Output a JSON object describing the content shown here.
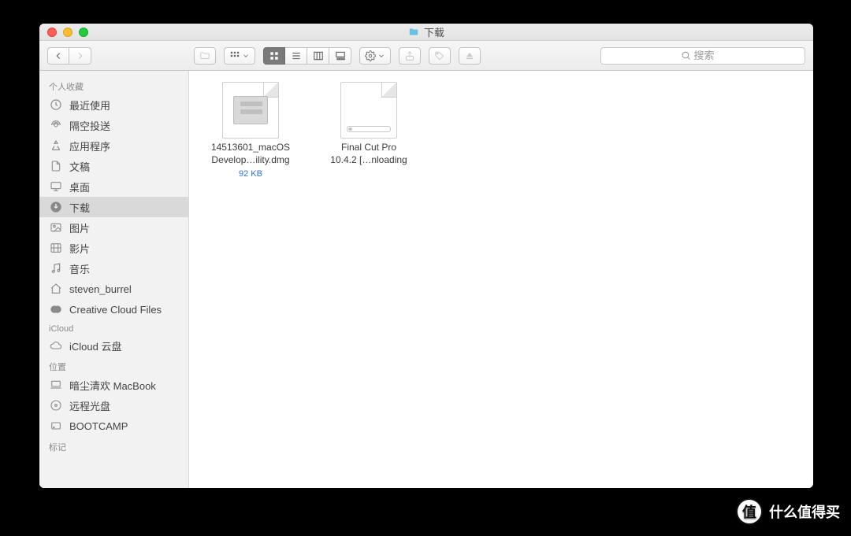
{
  "window": {
    "title": "下载"
  },
  "search": {
    "placeholder": "搜索"
  },
  "sidebar": {
    "sections": [
      {
        "header": "个人收藏",
        "items": [
          {
            "icon": "clock-icon",
            "label": "最近使用"
          },
          {
            "icon": "airdrop-icon",
            "label": "隔空投送"
          },
          {
            "icon": "apps-icon",
            "label": "应用程序"
          },
          {
            "icon": "doc-icon",
            "label": "文稿"
          },
          {
            "icon": "desktop-icon",
            "label": "桌面"
          },
          {
            "icon": "download-icon",
            "label": "下载",
            "selected": true
          },
          {
            "icon": "photo-icon",
            "label": "图片"
          },
          {
            "icon": "movie-icon",
            "label": "影片"
          },
          {
            "icon": "music-icon",
            "label": "音乐"
          },
          {
            "icon": "home-icon",
            "label": "steven_burrel"
          },
          {
            "icon": "cc-icon",
            "label": "Creative Cloud Files"
          }
        ]
      },
      {
        "header": "iCloud",
        "items": [
          {
            "icon": "cloud-icon",
            "label": "iCloud 云盘"
          }
        ]
      },
      {
        "header": "位置",
        "items": [
          {
            "icon": "laptop-icon",
            "label": "暗尘清欢 MacBook"
          },
          {
            "icon": "disc-icon",
            "label": "远程光盘"
          },
          {
            "icon": "drive-icon",
            "label": "BOOTCAMP"
          }
        ]
      },
      {
        "header": "标记",
        "items": []
      }
    ]
  },
  "files": [
    {
      "line1": "14513601_macOS",
      "line2": "Develop…ility.dmg",
      "meta": "92 KB",
      "kind": "dmg"
    },
    {
      "line1": "Final Cut Pro",
      "line2": "10.4.2 […nloading",
      "meta": "",
      "kind": "downloading"
    }
  ],
  "watermark": {
    "badge": "值",
    "text": "什么值得买"
  }
}
